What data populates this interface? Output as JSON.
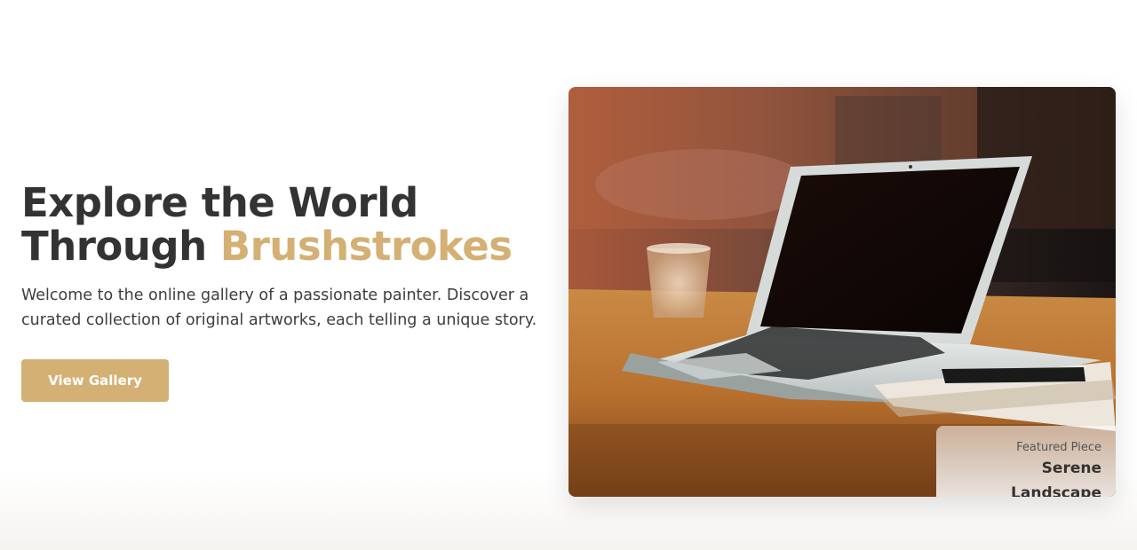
{
  "hero": {
    "title_line1": "Explore the World",
    "title_line2_prefix": "Through",
    "title_line2_accent": "Brushstrokes",
    "description": "Welcome to the online gallery of a passionate painter. Discover a curated collection of original artworks, each telling a unique story.",
    "cta_label": "View Gallery"
  },
  "featured": {
    "label": "Featured Piece",
    "title": "Serene Landscape",
    "image_subject": "laptop-on-wooden-table-photo"
  },
  "colors": {
    "accent": "#d4b074",
    "heading": "#333333",
    "body_text": "#3d3d3d"
  }
}
